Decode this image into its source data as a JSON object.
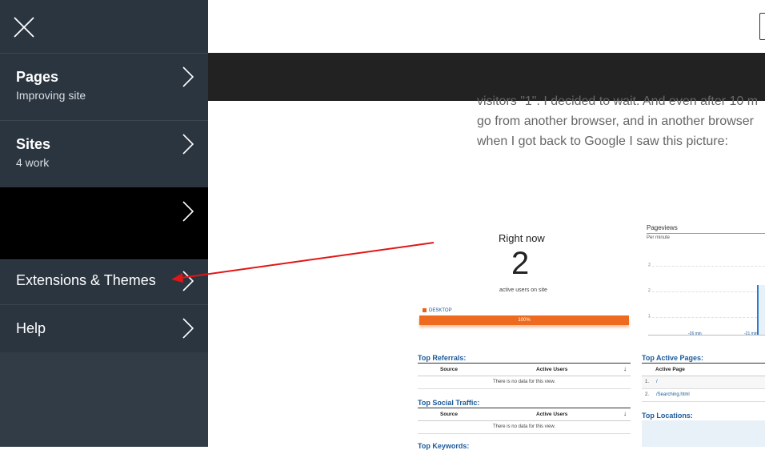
{
  "sidebar": {
    "items": [
      {
        "title": "Pages",
        "subtitle": "Improving site"
      },
      {
        "title": "Sites",
        "subtitle": "4 work"
      },
      {
        "title": "",
        "subtitle": ""
      },
      {
        "title": "Extensions & Themes",
        "subtitle": ""
      },
      {
        "title": "Help",
        "subtitle": ""
      }
    ]
  },
  "article": {
    "line1": "visitors \"1\". I decided to wait. And even after 10 m",
    "line2": "go from another browser, and in another browser",
    "line3": "when I got back to Google I saw this picture:"
  },
  "analytics": {
    "right_now": "Right now",
    "active_count": "2",
    "active_label": "active users on site",
    "device_label": "DESKTOP",
    "device_share": "100%",
    "device_share_value": 100,
    "top_referrals": "Top Referrals:",
    "top_social": "Top Social Traffic:",
    "top_keywords": "Top Keywords:",
    "col_source": "Source",
    "col_active_users": "Active Users",
    "no_data": "There is no data for this view.",
    "pageviews_title": "Pageviews",
    "pageviews_sub": "Per minute",
    "y_ticks": [
      "3",
      "2",
      "1"
    ],
    "x_ticks": [
      "-26 min",
      "-21 min"
    ],
    "top_active_pages": "Top Active Pages:",
    "col_active_page": "Active Page",
    "pages": [
      {
        "num": "1.",
        "path": "/"
      },
      {
        "num": "2.",
        "path": "/Searching.html"
      }
    ],
    "top_locations": "Top Locations:"
  },
  "colors": {
    "sidebar_bg": "#2b3540",
    "accent_orange": "#ed6a1e",
    "arrow_red": "#e31515",
    "link_blue": "#1a5a9a"
  }
}
